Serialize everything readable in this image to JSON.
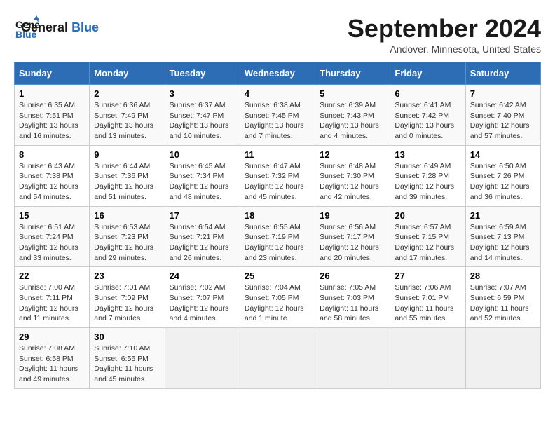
{
  "header": {
    "logo_line1": "General",
    "logo_line2": "Blue",
    "month_title": "September 2024",
    "location": "Andover, Minnesota, United States"
  },
  "weekdays": [
    "Sunday",
    "Monday",
    "Tuesday",
    "Wednesday",
    "Thursday",
    "Friday",
    "Saturday"
  ],
  "weeks": [
    [
      {
        "day": "1",
        "sunrise": "Sunrise: 6:35 AM",
        "sunset": "Sunset: 7:51 PM",
        "daylight": "Daylight: 13 hours and 16 minutes."
      },
      {
        "day": "2",
        "sunrise": "Sunrise: 6:36 AM",
        "sunset": "Sunset: 7:49 PM",
        "daylight": "Daylight: 13 hours and 13 minutes."
      },
      {
        "day": "3",
        "sunrise": "Sunrise: 6:37 AM",
        "sunset": "Sunset: 7:47 PM",
        "daylight": "Daylight: 13 hours and 10 minutes."
      },
      {
        "day": "4",
        "sunrise": "Sunrise: 6:38 AM",
        "sunset": "Sunset: 7:45 PM",
        "daylight": "Daylight: 13 hours and 7 minutes."
      },
      {
        "day": "5",
        "sunrise": "Sunrise: 6:39 AM",
        "sunset": "Sunset: 7:43 PM",
        "daylight": "Daylight: 13 hours and 4 minutes."
      },
      {
        "day": "6",
        "sunrise": "Sunrise: 6:41 AM",
        "sunset": "Sunset: 7:42 PM",
        "daylight": "Daylight: 13 hours and 0 minutes."
      },
      {
        "day": "7",
        "sunrise": "Sunrise: 6:42 AM",
        "sunset": "Sunset: 7:40 PM",
        "daylight": "Daylight: 12 hours and 57 minutes."
      }
    ],
    [
      {
        "day": "8",
        "sunrise": "Sunrise: 6:43 AM",
        "sunset": "Sunset: 7:38 PM",
        "daylight": "Daylight: 12 hours and 54 minutes."
      },
      {
        "day": "9",
        "sunrise": "Sunrise: 6:44 AM",
        "sunset": "Sunset: 7:36 PM",
        "daylight": "Daylight: 12 hours and 51 minutes."
      },
      {
        "day": "10",
        "sunrise": "Sunrise: 6:45 AM",
        "sunset": "Sunset: 7:34 PM",
        "daylight": "Daylight: 12 hours and 48 minutes."
      },
      {
        "day": "11",
        "sunrise": "Sunrise: 6:47 AM",
        "sunset": "Sunset: 7:32 PM",
        "daylight": "Daylight: 12 hours and 45 minutes."
      },
      {
        "day": "12",
        "sunrise": "Sunrise: 6:48 AM",
        "sunset": "Sunset: 7:30 PM",
        "daylight": "Daylight: 12 hours and 42 minutes."
      },
      {
        "day": "13",
        "sunrise": "Sunrise: 6:49 AM",
        "sunset": "Sunset: 7:28 PM",
        "daylight": "Daylight: 12 hours and 39 minutes."
      },
      {
        "day": "14",
        "sunrise": "Sunrise: 6:50 AM",
        "sunset": "Sunset: 7:26 PM",
        "daylight": "Daylight: 12 hours and 36 minutes."
      }
    ],
    [
      {
        "day": "15",
        "sunrise": "Sunrise: 6:51 AM",
        "sunset": "Sunset: 7:24 PM",
        "daylight": "Daylight: 12 hours and 33 minutes."
      },
      {
        "day": "16",
        "sunrise": "Sunrise: 6:53 AM",
        "sunset": "Sunset: 7:23 PM",
        "daylight": "Daylight: 12 hours and 29 minutes."
      },
      {
        "day": "17",
        "sunrise": "Sunrise: 6:54 AM",
        "sunset": "Sunset: 7:21 PM",
        "daylight": "Daylight: 12 hours and 26 minutes."
      },
      {
        "day": "18",
        "sunrise": "Sunrise: 6:55 AM",
        "sunset": "Sunset: 7:19 PM",
        "daylight": "Daylight: 12 hours and 23 minutes."
      },
      {
        "day": "19",
        "sunrise": "Sunrise: 6:56 AM",
        "sunset": "Sunset: 7:17 PM",
        "daylight": "Daylight: 12 hours and 20 minutes."
      },
      {
        "day": "20",
        "sunrise": "Sunrise: 6:57 AM",
        "sunset": "Sunset: 7:15 PM",
        "daylight": "Daylight: 12 hours and 17 minutes."
      },
      {
        "day": "21",
        "sunrise": "Sunrise: 6:59 AM",
        "sunset": "Sunset: 7:13 PM",
        "daylight": "Daylight: 12 hours and 14 minutes."
      }
    ],
    [
      {
        "day": "22",
        "sunrise": "Sunrise: 7:00 AM",
        "sunset": "Sunset: 7:11 PM",
        "daylight": "Daylight: 12 hours and 11 minutes."
      },
      {
        "day": "23",
        "sunrise": "Sunrise: 7:01 AM",
        "sunset": "Sunset: 7:09 PM",
        "daylight": "Daylight: 12 hours and 7 minutes."
      },
      {
        "day": "24",
        "sunrise": "Sunrise: 7:02 AM",
        "sunset": "Sunset: 7:07 PM",
        "daylight": "Daylight: 12 hours and 4 minutes."
      },
      {
        "day": "25",
        "sunrise": "Sunrise: 7:04 AM",
        "sunset": "Sunset: 7:05 PM",
        "daylight": "Daylight: 12 hours and 1 minute."
      },
      {
        "day": "26",
        "sunrise": "Sunrise: 7:05 AM",
        "sunset": "Sunset: 7:03 PM",
        "daylight": "Daylight: 11 hours and 58 minutes."
      },
      {
        "day": "27",
        "sunrise": "Sunrise: 7:06 AM",
        "sunset": "Sunset: 7:01 PM",
        "daylight": "Daylight: 11 hours and 55 minutes."
      },
      {
        "day": "28",
        "sunrise": "Sunrise: 7:07 AM",
        "sunset": "Sunset: 6:59 PM",
        "daylight": "Daylight: 11 hours and 52 minutes."
      }
    ],
    [
      {
        "day": "29",
        "sunrise": "Sunrise: 7:08 AM",
        "sunset": "Sunset: 6:58 PM",
        "daylight": "Daylight: 11 hours and 49 minutes."
      },
      {
        "day": "30",
        "sunrise": "Sunrise: 7:10 AM",
        "sunset": "Sunset: 6:56 PM",
        "daylight": "Daylight: 11 hours and 45 minutes."
      },
      null,
      null,
      null,
      null,
      null
    ]
  ]
}
